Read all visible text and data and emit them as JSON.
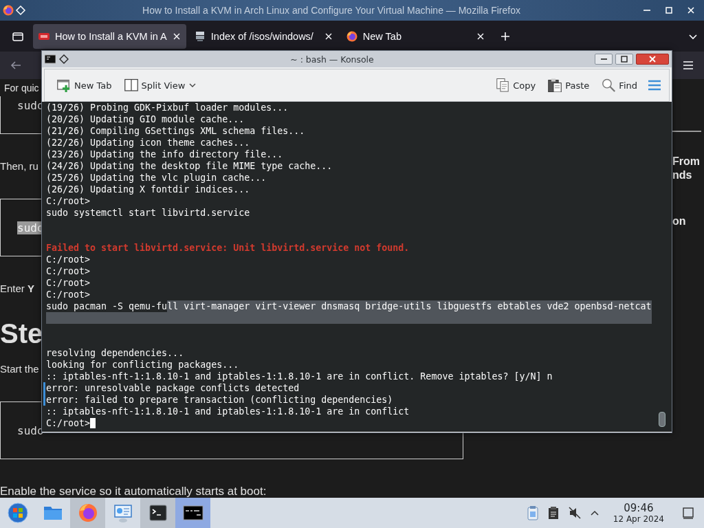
{
  "firefox": {
    "title": "How to Install a KVM in Arch Linux and Configure Your Virtual Machine — Mozilla Firefox",
    "tabs": [
      {
        "label": "How to Install a KVM in A",
        "selected": true,
        "kind": "article"
      },
      {
        "label": "Index of /isos/windows/",
        "selected": false,
        "kind": "server"
      },
      {
        "label": "New Tab",
        "selected": false,
        "kind": "firefox"
      }
    ],
    "page": {
      "banner": "For quic",
      "left": [
        {
          "kind": "code",
          "text": "sudo",
          "highlighted": false
        },
        {
          "kind": "text",
          "text": "Then, ru"
        },
        {
          "kind": "code",
          "text": "sudo",
          "highlighted": true
        },
        {
          "kind": "text",
          "text": "Enter **Y**"
        },
        {
          "kind": "heading",
          "text": "Ste"
        },
        {
          "kind": "text",
          "text": "Start the"
        },
        {
          "kind": "code",
          "text": "sudo",
          "highlighted": false
        },
        {
          "kind": "text",
          "text": "Enable the service so it automatically starts at boot:"
        }
      ],
      "right": [
        {
          "kind": "rule"
        },
        {
          "kind": "text",
          "text": "From"
        },
        {
          "kind": "text",
          "text": "nds"
        },
        {
          "kind": "gap"
        },
        {
          "kind": "text",
          "text": "on"
        }
      ]
    }
  },
  "konsole": {
    "title": "~ : bash — Konsole",
    "toolbar_left": [
      {
        "label": "New Tab",
        "kind": "new-tab"
      },
      {
        "label": "Split View",
        "kind": "split-view"
      }
    ],
    "toolbar_right": [
      {
        "label": "Copy",
        "kind": "copy"
      },
      {
        "label": "Paste",
        "kind": "paste"
      },
      {
        "label": "Find",
        "kind": "find"
      }
    ],
    "lines": [
      {
        "kind": "output",
        "text": "(19/26) Probing GDK-Pixbuf loader modules...",
        "marked": false
      },
      {
        "kind": "output",
        "text": "(20/26) Updating GIO module cache...",
        "marked": false
      },
      {
        "kind": "output",
        "text": "(21/26) Compiling GSettings XML schema files...",
        "marked": false
      },
      {
        "kind": "output",
        "text": "(22/26) Updating icon theme caches...",
        "marked": false
      },
      {
        "kind": "output",
        "text": "(23/26) Updating the info directory file...",
        "marked": false
      },
      {
        "kind": "output",
        "text": "(24/26) Updating the desktop file MIME type cache...",
        "marked": false
      },
      {
        "kind": "output",
        "text": "(25/26) Updating the vlc plugin cache...",
        "marked": false
      },
      {
        "kind": "output",
        "text": "(26/26) Updating X fontdir indices...",
        "marked": false
      },
      {
        "kind": "prompt",
        "text": "C:/root>",
        "cursor": false,
        "marked": false
      },
      {
        "kind": "output",
        "text": "sudo systemctl start libvirtd.service",
        "marked": false
      },
      {
        "kind": "blank",
        "selected": false
      },
      {
        "kind": "blank",
        "selected": false
      },
      {
        "kind": "error",
        "text": "Failed to start libvirtd.service: Unit libvirtd.service not found.",
        "marked": false
      },
      {
        "kind": "prompt",
        "text": "C:/root>",
        "cursor": false,
        "marked": false
      },
      {
        "kind": "prompt",
        "text": "C:/root>",
        "cursor": false,
        "marked": false
      },
      {
        "kind": "prompt",
        "text": "C:/root>",
        "cursor": false,
        "marked": false
      },
      {
        "kind": "prompt",
        "text": "C:/root>",
        "cursor": false,
        "marked": false
      },
      {
        "kind": "segmented",
        "segments": [
          {
            "text": "sudo pacman -S qemu-fu",
            "selected": false
          },
          {
            "text": "ll virt-manager virt-viewer dnsmasq bridge-utils libguestfs ebtables vde2 openbsd-netcat",
            "selected": true
          }
        ],
        "marked": false
      },
      {
        "kind": "blank",
        "selected": true
      },
      {
        "kind": "blank",
        "selected": false
      },
      {
        "kind": "blank",
        "selected": false
      },
      {
        "kind": "output",
        "text": "resolving dependencies...",
        "marked": false
      },
      {
        "kind": "output",
        "text": "looking for conflicting packages...",
        "marked": false
      },
      {
        "kind": "output",
        "text": ":: iptables-nft-1:1.8.10-1 and iptables-1:1.8.10-1 are in conflict. Remove iptables? [y/N] n",
        "marked": false
      },
      {
        "kind": "output",
        "text": "error: unresolvable package conflicts detected",
        "marked": true
      },
      {
        "kind": "output",
        "text": "error: failed to prepare transaction (conflicting dependencies)",
        "marked": true
      },
      {
        "kind": "output",
        "text": ":: iptables-nft-1:1.8.10-1 and iptables-1:1.8.10-1 are in conflict",
        "marked": false
      },
      {
        "kind": "prompt",
        "text": "C:/root>",
        "cursor": true,
        "marked": false
      }
    ]
  },
  "taskbar": {
    "items": [
      {
        "kind": "start",
        "open": false,
        "focused": false
      },
      {
        "kind": "files",
        "open": false,
        "focused": false
      },
      {
        "kind": "firefox",
        "open": true,
        "focused": false
      },
      {
        "kind": "network",
        "open": false,
        "focused": false
      },
      {
        "kind": "terminal",
        "open": true,
        "focused": false
      },
      {
        "kind": "konsole",
        "open": true,
        "focused": true
      }
    ],
    "time": "09:46",
    "date": "12 Apr 2024"
  }
}
